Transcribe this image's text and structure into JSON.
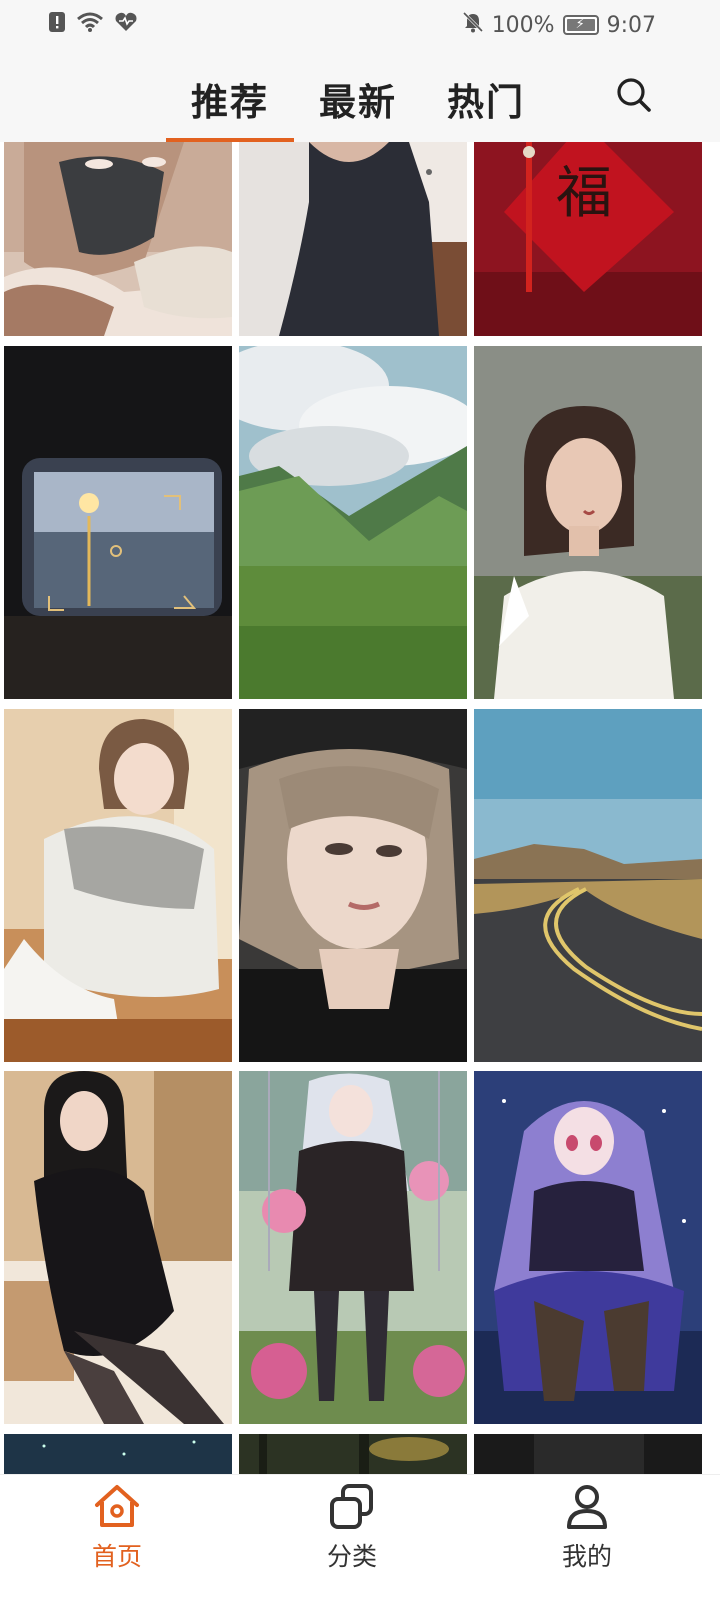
{
  "status_bar": {
    "battery_text": "100%",
    "time": "9:07",
    "icons": [
      "alert-icon",
      "wifi-icon",
      "heart-pulse-icon",
      "mute-bell-icon",
      "battery-icon"
    ]
  },
  "top_tabs": [
    {
      "label": "推荐",
      "active": true
    },
    {
      "label": "最新",
      "active": false
    },
    {
      "label": "热门",
      "active": false
    }
  ],
  "search_icon": "search-icon",
  "wallpapers": [
    {
      "subject": "woman-in-black-mask"
    },
    {
      "subject": "woman-in-black-dress"
    },
    {
      "subject": "red-fu-decoration"
    },
    {
      "subject": "sunset-through-viewfinder"
    },
    {
      "subject": "green-mountain-valley"
    },
    {
      "subject": "woman-in-white-blouse"
    },
    {
      "subject": "girl-in-white-cardigan"
    },
    {
      "subject": "woman-with-cap-portrait"
    },
    {
      "subject": "winding-road-landscape"
    },
    {
      "subject": "woman-in-black-velvet-dress"
    },
    {
      "subject": "anime-girl-on-swing"
    },
    {
      "subject": "anime-girl-purple-hair"
    },
    {
      "subject": "night-sky-partial"
    },
    {
      "subject": "forest-partial"
    },
    {
      "subject": "dark-partial"
    }
  ],
  "bottom_nav": [
    {
      "label": "首页",
      "icon": "home-icon",
      "active": true
    },
    {
      "label": "分类",
      "icon": "category-icon",
      "active": false
    },
    {
      "label": "我的",
      "icon": "profile-icon",
      "active": false
    }
  ],
  "colors": {
    "accent": "#e2611f",
    "text": "#222222",
    "bar_background": "#f7f7f7"
  }
}
